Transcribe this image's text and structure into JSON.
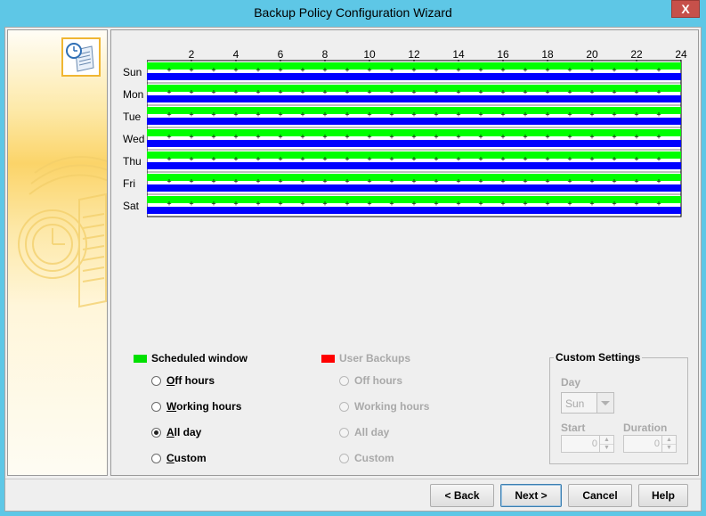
{
  "window": {
    "title": "Backup Policy Configuration Wizard",
    "close_label": "X"
  },
  "schedule": {
    "days": [
      "Sun",
      "Mon",
      "Tue",
      "Wed",
      "Thu",
      "Fri",
      "Sat"
    ],
    "hour_labels": [
      "2",
      "4",
      "6",
      "8",
      "10",
      "12",
      "14",
      "16",
      "18",
      "20",
      "22",
      "24"
    ],
    "hours_start": 0,
    "hours_end": 24,
    "scheduled_window_color": "#00ff00",
    "user_backups_color": "#0000ff",
    "scheduled_window_hours": [
      0,
      24
    ],
    "user_backup_hours": [
      0,
      24
    ]
  },
  "legend": {
    "scheduled_window": "Scheduled window",
    "scheduled_color": "#00e000",
    "user_backups": "User Backups",
    "user_backups_color": "#ff0000"
  },
  "scheduled_options": [
    {
      "label": "Off hours",
      "checked": false
    },
    {
      "label": "Working hours",
      "checked": false
    },
    {
      "label": "All day",
      "checked": true
    },
    {
      "label": "Custom",
      "checked": false
    }
  ],
  "user_options": [
    {
      "label": "Off hours",
      "checked": false
    },
    {
      "label": "Working hours",
      "checked": false
    },
    {
      "label": "All day",
      "checked": false
    },
    {
      "label": "Custom",
      "checked": false
    }
  ],
  "custom_settings": {
    "title": "Custom Settings",
    "day_label": "Day",
    "day_value": "Sun",
    "start_label": "Start",
    "start_value": "0",
    "duration_label": "Duration",
    "duration_value": "0"
  },
  "buttons": {
    "back": "< Back",
    "next": "Next >",
    "cancel": "Cancel",
    "help": "Help"
  }
}
